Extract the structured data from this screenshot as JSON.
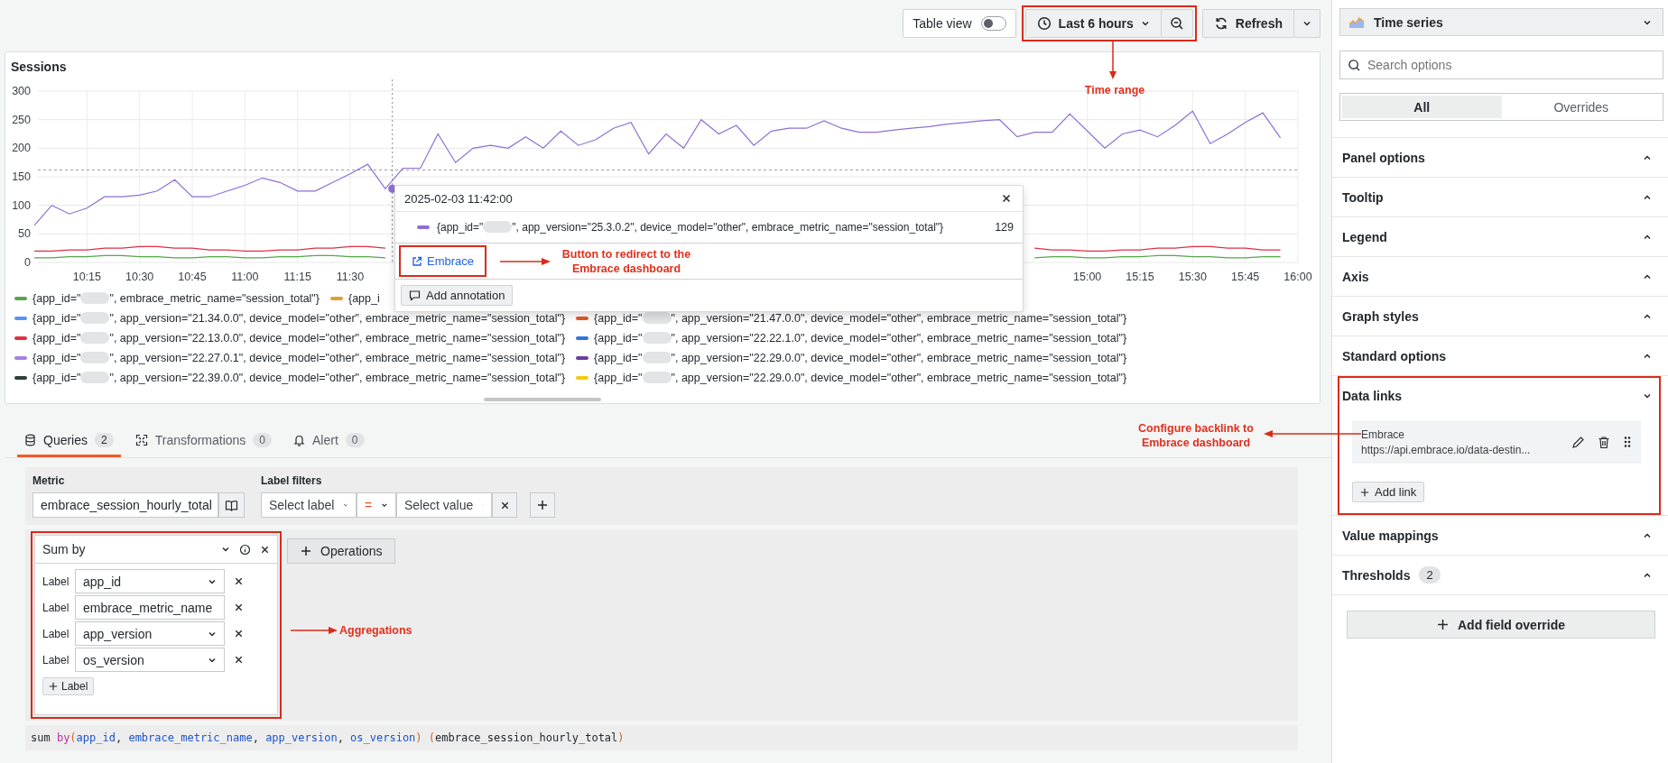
{
  "toolbar": {
    "table_view": {
      "label": "Table view",
      "on": false
    },
    "time_range": {
      "label": "Last 6 hours",
      "highlighted": true
    },
    "refresh": {
      "label": "Refresh"
    }
  },
  "panel": {
    "title": "Sessions",
    "chart_data": {
      "type": "line",
      "grid": true,
      "ref_lines": [
        {
          "axis": "y",
          "value": 162
        },
        {
          "axis": "x",
          "value": 702
        }
      ],
      "xlim": [
        600,
        960
      ],
      "ylim": [
        0,
        300
      ],
      "yticks": [
        0,
        50,
        100,
        150,
        200,
        250,
        300
      ],
      "xticks": [
        {
          "value": 615,
          "label": "10:15"
        },
        {
          "value": 630,
          "label": "10:30"
        },
        {
          "value": 645,
          "label": "10:45"
        },
        {
          "value": 660,
          "label": "11:00"
        },
        {
          "value": 675,
          "label": "11:15"
        },
        {
          "value": 690,
          "label": "11:30"
        },
        {
          "value": 900,
          "label": "15:00"
        },
        {
          "value": 915,
          "label": "15:15"
        },
        {
          "value": 930,
          "label": "15:30"
        },
        {
          "value": 945,
          "label": "15:45"
        },
        {
          "value": 960,
          "label": "16:00"
        }
      ],
      "x": [
        600,
        605,
        610,
        615,
        620,
        625,
        630,
        635,
        640,
        645,
        650,
        655,
        660,
        665,
        670,
        675,
        680,
        685,
        690,
        695,
        700,
        705,
        710,
        715,
        720,
        725,
        730,
        735,
        740,
        745,
        750,
        755,
        760,
        765,
        770,
        775,
        780,
        785,
        790,
        795,
        800,
        805,
        810,
        815,
        820,
        825,
        830,
        835,
        840,
        845,
        850,
        855,
        860,
        865,
        870,
        875,
        880,
        885,
        890,
        895,
        900,
        905,
        910,
        915,
        920,
        925,
        930,
        935,
        940,
        945,
        950,
        955
      ],
      "series": [
        {
          "color": "#8f6fd6",
          "values": [
            65,
            100,
            85,
            95,
            115,
            115,
            118,
            125,
            145,
            115,
            115,
            125,
            135,
            148,
            140,
            125,
            125,
            140,
            155,
            172,
            129,
            165,
            165,
            225,
            175,
            200,
            205,
            200,
            220,
            200,
            230,
            205,
            215,
            235,
            245,
            190,
            225,
            200,
            250,
            225,
            240,
            205,
            230,
            235,
            235,
            248,
            235,
            228,
            228,
            232,
            235,
            238,
            242,
            245,
            248,
            250,
            220,
            228,
            228,
            260,
            230,
            200,
            225,
            232,
            220,
            240,
            265,
            208,
            225,
            245,
            262,
            218
          ]
        },
        {
          "color": "#e02f44",
          "values": [
            20,
            20,
            22,
            22,
            25,
            25,
            28,
            28,
            25,
            25,
            22,
            22,
            20,
            20,
            22,
            22,
            25,
            25,
            28,
            28,
            25,
            null,
            null,
            null,
            null,
            null,
            null,
            null,
            null,
            null,
            null,
            null,
            null,
            null,
            null,
            null,
            null,
            null,
            null,
            null,
            null,
            null,
            null,
            null,
            null,
            null,
            null,
            null,
            null,
            null,
            null,
            null,
            null,
            null,
            null,
            null,
            null,
            25,
            22,
            22,
            20,
            20,
            22,
            22,
            25,
            25,
            28,
            28,
            25,
            25,
            22,
            22
          ]
        },
        {
          "color": "#56a64b",
          "values": [
            8,
            8,
            10,
            10,
            12,
            12,
            10,
            10,
            8,
            8,
            10,
            10,
            8,
            8,
            10,
            10,
            12,
            12,
            10,
            10,
            8,
            null,
            null,
            null,
            null,
            null,
            null,
            null,
            null,
            null,
            null,
            null,
            null,
            null,
            null,
            null,
            null,
            null,
            null,
            null,
            null,
            null,
            null,
            null,
            null,
            null,
            null,
            null,
            null,
            null,
            null,
            null,
            null,
            null,
            null,
            null,
            null,
            8,
            10,
            10,
            8,
            8,
            10,
            10,
            12,
            12,
            10,
            10,
            8,
            8,
            10,
            10
          ]
        }
      ]
    },
    "tooltip": {
      "time": "2025-02-03 11:42:00",
      "series": {
        "prefix": "{app_id=\"",
        "blurred": true,
        "suffix": "\", app_version=\"25.3.0.2\", device_model=\"other\", embrace_metric_name=\"session_total\"}",
        "color": "#8f6fd6",
        "value": "129"
      },
      "link": {
        "label": "Embrace",
        "highlighted": true
      },
      "annotate": "Add annotation"
    },
    "legend": {
      "items": [
        {
          "prefix": "{app_id=\"",
          "blurred": true,
          "suffix": "\", embrace_metric_name=\"session_total\"}",
          "color": "#56a64b"
        },
        {
          "prefix": "{app_i",
          "blurred": false,
          "color": "#e0a030"
        },
        {
          "prefix": "{app_id=\"",
          "blurred": true,
          "suffix": "\", app_version=\"21.34.0.0\", device_model=\"other\", embrace_metric_name=\"session_total\"}",
          "color": "#5794f2"
        },
        {
          "prefix": "{app_id=\"",
          "blurred": true,
          "suffix": "\", app_version=\"21.47.0.0\", device_model=\"other\", embrace_metric_name=\"session_total\"}",
          "color": "#e8542b"
        },
        {
          "prefix": "{app_id=\"",
          "blurred": true,
          "suffix": "\", app_version=\"22.13.0.0\", device_model=\"other\", embrace_metric_name=\"session_total\"}",
          "color": "#e02f44"
        },
        {
          "prefix": "{app_id=\"",
          "blurred": true,
          "suffix": "\", app_version=\"22.22.1.0\", device_model=\"other\", embrace_metric_name=\"session_total\"}",
          "color": "#3274d9"
        },
        {
          "prefix": "{app_id=\"",
          "blurred": true,
          "suffix": "\", app_version=\"22.27.0.1\", device_model=\"other\", embrace_metric_name=\"session_total\"}",
          "color": "#a77fe0"
        },
        {
          "prefix": "{app_id=\"",
          "blurred": true,
          "suffix": "\", app_version=\"22.29.0.0\", device_model=\"other\", embrace_metric_name=\"session_total\"}",
          "color": "#6a3d9a"
        },
        {
          "prefix": "{app_id=\"",
          "blurred": true,
          "suffix": "\", app_version=\"22.39.0.0\", device_model=\"other\", embrace_metric_name=\"session_total\"}",
          "color": "#2f3f3a"
        },
        {
          "prefix": "{app_id=\"",
          "blurred": true,
          "suffix": "\", app_version=\"22.29.0.0\", device_model=\"other\", embrace_metric_name=\"session_total\"}",
          "color": "#f2cc0c"
        }
      ]
    }
  },
  "tabs": [
    {
      "label": "Queries",
      "count": "2",
      "kind": "database",
      "selected": true
    },
    {
      "label": "Transformations",
      "count": "0",
      "kind": "transform",
      "selected": false
    },
    {
      "label": "Alert",
      "count": "0",
      "kind": "bell",
      "selected": false
    }
  ],
  "query": {
    "metric_label": "Metric",
    "metric": "embrace_session_hourly_total",
    "filters_label": "Label filters",
    "filter": {
      "label_placeholder": "Select label",
      "operator": "=",
      "value_placeholder": "Select value"
    },
    "operation": {
      "title": "Sum by",
      "highlighted": true,
      "labels": [
        {
          "caption": "Label",
          "value": "app_id"
        },
        {
          "caption": "Label",
          "value": "embrace_metric_name"
        },
        {
          "caption": "Label",
          "value": "app_version"
        },
        {
          "caption": "Label",
          "value": "os_version"
        }
      ],
      "add_label": "Label"
    },
    "operations_button": "Operations",
    "code": [
      {
        "text": "sum ",
        "kind": "plain"
      },
      {
        "text": "by",
        "kind": "keyword"
      },
      {
        "text": "(",
        "kind": "paren"
      },
      {
        "text": "app_id",
        "kind": "label"
      },
      {
        "text": ", ",
        "kind": "plain"
      },
      {
        "text": "embrace_metric_name",
        "kind": "label"
      },
      {
        "text": ", ",
        "kind": "plain"
      },
      {
        "text": "app_version",
        "kind": "label"
      },
      {
        "text": ", ",
        "kind": "plain"
      },
      {
        "text": "os_version",
        "kind": "label"
      },
      {
        "text": ")",
        "kind": "paren"
      },
      {
        "text": " (",
        "kind": "paren"
      },
      {
        "text": "embrace_session_hourly_total",
        "kind": "plain"
      },
      {
        "text": ")",
        "kind": "paren"
      }
    ]
  },
  "options": {
    "visualization": "Time series",
    "search_placeholder": "Search options",
    "tabs": [
      {
        "label": "All",
        "selected": true
      },
      {
        "label": "Overrides",
        "selected": false
      }
    ],
    "sections": [
      {
        "title": "Panel options",
        "expanded": false,
        "highlighted": false
      },
      {
        "title": "Tooltip",
        "expanded": false,
        "highlighted": false
      },
      {
        "title": "Legend",
        "expanded": false,
        "highlighted": false
      },
      {
        "title": "Axis",
        "expanded": false,
        "highlighted": false
      },
      {
        "title": "Graph styles",
        "expanded": false,
        "highlighted": false
      },
      {
        "title": "Standard options",
        "expanded": false,
        "highlighted": false
      },
      {
        "title": "Data links",
        "expanded": true,
        "highlighted": true,
        "links": [
          {
            "title": "Embrace",
            "url": "https://api.embrace.io/data-destin..."
          }
        ],
        "add_link": "Add link"
      },
      {
        "title": "Value mappings",
        "expanded": false,
        "highlighted": false
      },
      {
        "title": "Thresholds",
        "expanded": false,
        "highlighted": false,
        "count": "2"
      }
    ],
    "add_override": "Add field override"
  },
  "notes": [
    {
      "text": "Time range"
    },
    {
      "text": "Button to redirect to the Embrace dashboard"
    },
    {
      "text": "Configure backlink to Embrace dashboard"
    },
    {
      "text": "Aggregations"
    }
  ]
}
